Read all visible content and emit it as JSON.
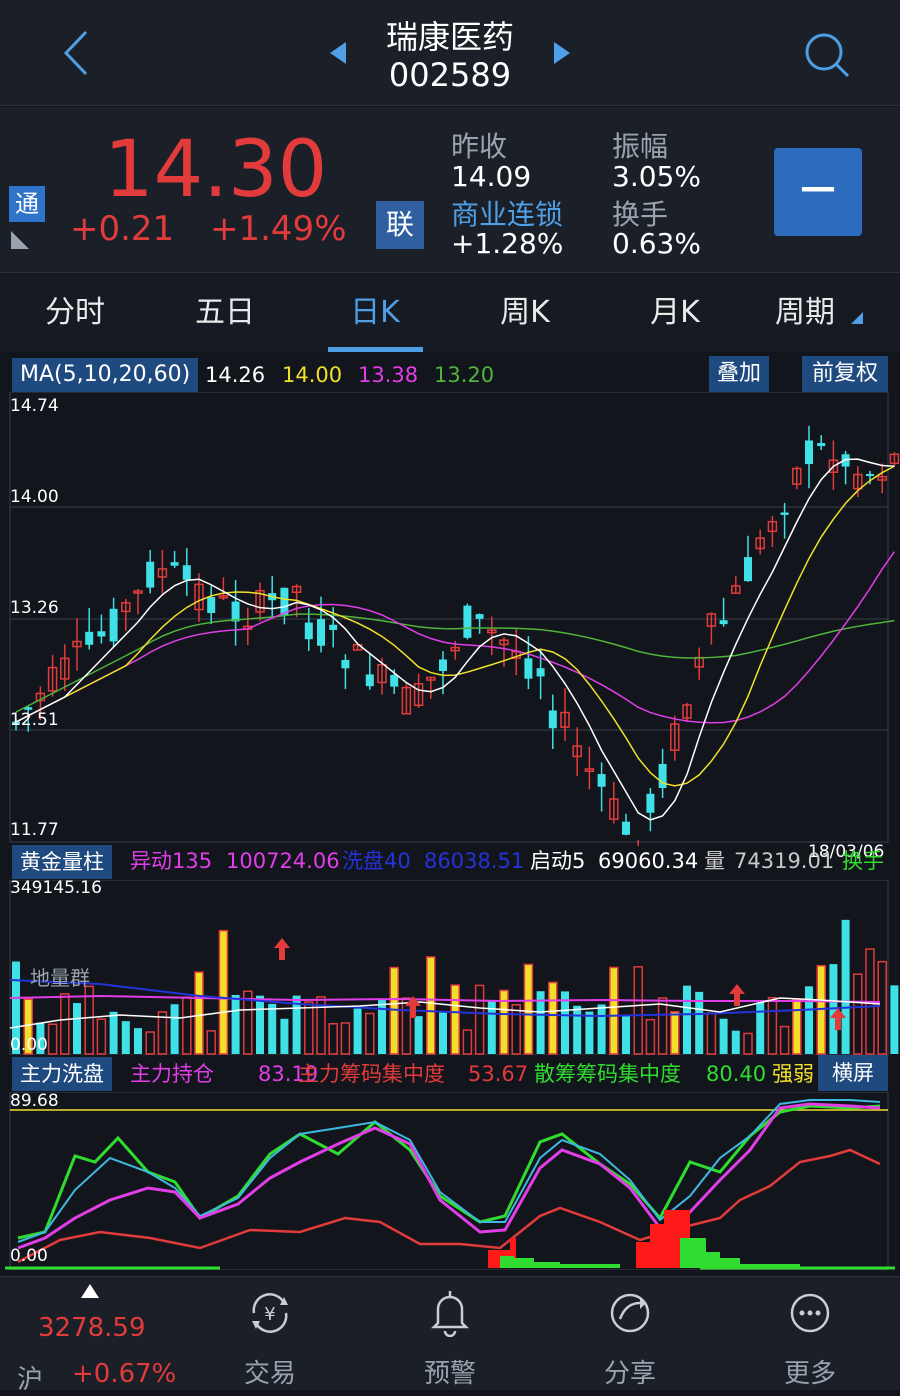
{
  "header": {
    "stock_name": "瑞康医药",
    "stock_code": "002589"
  },
  "quote": {
    "price": "14.30",
    "change": "+0.21",
    "change_pct": "+1.49%",
    "tong_badge": "通",
    "lian_badge": "联",
    "prev_close_label": "昨收",
    "prev_close": "14.09",
    "sector_name": "商业连锁",
    "sector_change": "+1.28%",
    "amplitude_label": "振幅",
    "amplitude": "3.05%",
    "turnover_label": "换手",
    "turnover": "0.63%",
    "minus_button": "—"
  },
  "tabs": [
    {
      "label": "分时"
    },
    {
      "label": "五日"
    },
    {
      "label": "日K"
    },
    {
      "label": "周K"
    },
    {
      "label": "月K"
    },
    {
      "label": "周期"
    }
  ],
  "kline": {
    "ma_label": "MA(5,10,20,60)",
    "ma5": "14.26",
    "ma10": "14.00",
    "ma20": "13.38",
    "ma60": "13.20",
    "overlay_button": "叠加",
    "adjust_button": "前复权",
    "y_labels": [
      "14.74",
      "14.00",
      "13.26",
      "12.51",
      "11.77"
    ],
    "date_label": "18/03/06",
    "colors": {
      "up": "#e23b3b",
      "down": "#3fe0e6",
      "ma5": "#ffffff",
      "ma10": "#f0e02a",
      "ma20": "#e13ee8",
      "ma60": "#4fb53a"
    }
  },
  "volume": {
    "indicator_label": "黄金量柱",
    "yidong_label": "异动135",
    "yidong_value": "100724.06",
    "xipan_label": "洗盘40",
    "xipan_value": "86038.51",
    "qidong_label": "启动5",
    "qidong_value": "69060.34",
    "liang_label": "量",
    "liang_value": "74319.01",
    "huanshou_label": "换手",
    "top_value": "349145.16",
    "bottom_value": "0.00",
    "annotation": "地量群"
  },
  "zhuli": {
    "indicator_label": "主力洗盘",
    "chicang_label": "主力持仓",
    "chicang_value": "83.19",
    "jizhong_label": "主力筹码集中度",
    "jizhong_value": "53.67",
    "sanchou_label": "散筹筹码集中度",
    "sanchou_value": "80.40",
    "qiangruo_label": "强弱",
    "landscape_button": "横屏",
    "top_value": "89.68",
    "bottom_value": "0.00"
  },
  "bottom_nav": {
    "index_value": "3278.59",
    "index_market": "沪",
    "index_change": "+0.67%",
    "items": [
      {
        "label": "交易",
        "icon": "yuan-exchange-icon"
      },
      {
        "label": "预警",
        "icon": "bell-icon"
      },
      {
        "label": "分享",
        "icon": "share-icon"
      },
      {
        "label": "更多",
        "icon": "more-icon"
      }
    ]
  }
}
